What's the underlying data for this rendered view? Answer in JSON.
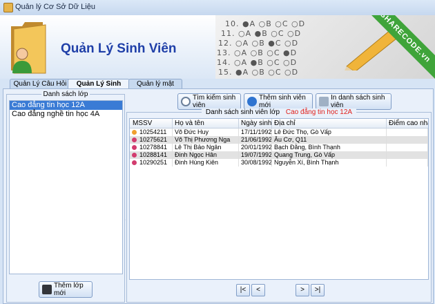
{
  "window": {
    "title": "Quản lý Cơ Sở Dữ Liệu"
  },
  "header": {
    "heading": "Quản Lý Sinh Viên",
    "banner_rows": [
      "10. ●A ○B ○C ○D",
      "11. ○A ●B ○C ○D",
      "12. ○A ○B ●C ○D",
      "13. ○A ○B ○C ●D",
      "14. ○A ●B ○C ○D",
      "15. ●A ○B ○C ○D"
    ],
    "ribbon_text": "SHARECODE.vn"
  },
  "tabs": [
    "Quản Lý Câu Hỏi",
    "Quản Lý Sinh Viên",
    "Quản lý mật khẩu"
  ],
  "class_panel": {
    "title": "Danh sách lớp",
    "items": [
      "Cao đẳng tin học 12A",
      "Cao đẳng nghề tin học 4A"
    ],
    "add_button": "Thêm lớp mới"
  },
  "toolbar": {
    "search": "Tìm kiếm sinh viên",
    "add_student": "Thêm sinh viên mới",
    "print": "In danh sách sinh viên"
  },
  "student_panel": {
    "title_prefix": "Danh sách sinh viên lớp",
    "title_class": "Cao đẳng tin học 12A",
    "columns": [
      "MSSV",
      "Họ và tên",
      "Ngày sinh",
      "Địa chỉ",
      "Điểm cao nhất"
    ],
    "rows": [
      [
        "10254211",
        "Võ Đức Huy",
        "17/11/1992",
        "Lê Đức Thọ, Gò Vấp",
        ""
      ],
      [
        "10275621",
        "Võ Thị Phương Nga",
        "21/06/1992",
        "Âu Cơ, Q11",
        ""
      ],
      [
        "10278841",
        "Lê Thị Bảo Ngân",
        "20/01/1992",
        "Bạch Đằng, Bình Thạnh",
        ""
      ],
      [
        "10288141",
        "Đinh Ngọc Hân",
        "19/07/1992",
        "Quang Trung, Gò Vấp",
        ""
      ],
      [
        "10290251",
        "Đinh Hùng Kiên",
        "30/08/1992",
        "Nguyễn Xí, Bình Thạnh",
        ""
      ]
    ]
  },
  "pager": [
    "|<",
    "<",
    ">",
    ">|"
  ],
  "watermark": "SHARECODE.vn",
  "colors": {
    "heading": "#1f3fa8",
    "selected": "#3a7bd5",
    "class_title": "#e0201b",
    "ribbon": "#3fa43a"
  }
}
